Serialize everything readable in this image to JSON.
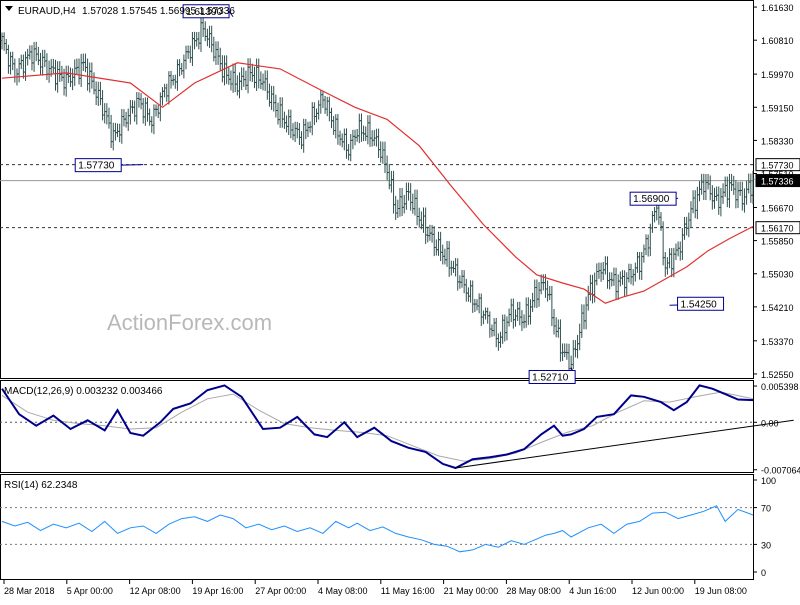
{
  "header": {
    "symbol": "EURAUD,H4",
    "ohlc": "1.57028 1.57545 1.56995 1.57336"
  },
  "watermark": "ActionForex.com",
  "colors": {
    "bars": "#2f4f4f",
    "ma": "#e03030",
    "macd": "#00008b",
    "macd_signal": "#a9a9a9",
    "rsi": "#1e90ff",
    "grid": "#000000",
    "frame": "#000000",
    "label_border": "#00008b"
  },
  "chart_data": [
    {
      "type": "ohlc",
      "panel": "price",
      "title": "EURAUD,H4",
      "y_ticks": [
        "1.61630",
        "1.60810",
        "1.59970",
        "1.59150",
        "1.58330",
        "1.57510",
        "1.56670",
        "1.55850",
        "1.55030",
        "1.54210",
        "1.53370",
        "1.52550"
      ],
      "ylim": [
        1.5245,
        1.6178
      ],
      "x_ticks": [
        "28 Mar 2018",
        "5 Apr 00:00",
        "12 Apr 08:00",
        "19 Apr 16:00",
        "27 Apr 00:00",
        "4 May 08:00",
        "11 May 16:00",
        "21 May 00:00",
        "28 May 08:00",
        "4 Jun 16:00",
        "12 Jun 00:00",
        "19 Jun 08:00"
      ],
      "close_path": [
        [
          0,
          1.608
        ],
        [
          6,
          1.6
        ],
        [
          14,
          1.605
        ],
        [
          22,
          1.601
        ],
        [
          30,
          1.598
        ],
        [
          38,
          1.602
        ],
        [
          46,
          1.593
        ],
        [
          52,
          1.584
        ],
        [
          58,
          1.589
        ],
        [
          64,
          1.593
        ],
        [
          70,
          1.588
        ],
        [
          76,
          1.596
        ],
        [
          82,
          1.6
        ],
        [
          88,
          1.606
        ],
        [
          94,
          1.611
        ],
        [
          98,
          1.607
        ],
        [
          104,
          1.6
        ],
        [
          110,
          1.597
        ],
        [
          116,
          1.6
        ],
        [
          122,
          1.598
        ],
        [
          128,
          1.591
        ],
        [
          134,
          1.587
        ],
        [
          140,
          1.584
        ],
        [
          146,
          1.59
        ],
        [
          150,
          1.594
        ],
        [
          156,
          1.586
        ],
        [
          162,
          1.581
        ],
        [
          166,
          1.586
        ],
        [
          172,
          1.585
        ],
        [
          176,
          1.582
        ],
        [
          180,
          1.576
        ],
        [
          184,
          1.566
        ],
        [
          190,
          1.57
        ],
        [
          196,
          1.563
        ],
        [
          202,
          1.558
        ],
        [
          208,
          1.554
        ],
        [
          214,
          1.549
        ],
        [
          220,
          1.544
        ],
        [
          226,
          1.54
        ],
        [
          232,
          1.534
        ],
        [
          238,
          1.541
        ],
        [
          244,
          1.539
        ],
        [
          250,
          1.546
        ],
        [
          254,
          1.548
        ],
        [
          258,
          1.538
        ],
        [
          262,
          1.531
        ],
        [
          266,
          1.528
        ],
        [
          270,
          1.536
        ],
        [
          274,
          1.545
        ],
        [
          280,
          1.552
        ],
        [
          286,
          1.548
        ],
        [
          292,
          1.549
        ],
        [
          298,
          1.553
        ],
        [
          302,
          1.559
        ],
        [
          306,
          1.568
        ],
        [
          310,
          1.552
        ],
        [
          316,
          1.556
        ],
        [
          322,
          1.566
        ],
        [
          328,
          1.573
        ],
        [
          334,
          1.568
        ],
        [
          340,
          1.572
        ],
        [
          346,
          1.569
        ],
        [
          351,
          1.573
        ]
      ],
      "ma_path": [
        [
          0,
          1.5987
        ],
        [
          30,
          1.6
        ],
        [
          60,
          1.5975
        ],
        [
          75,
          1.5915
        ],
        [
          90,
          1.5975
        ],
        [
          110,
          1.6025
        ],
        [
          130,
          1.601
        ],
        [
          150,
          1.5955
        ],
        [
          165,
          1.5915
        ],
        [
          180,
          1.5885
        ],
        [
          195,
          1.582
        ],
        [
          210,
          1.572
        ],
        [
          225,
          1.5625
        ],
        [
          240,
          1.5545
        ],
        [
          250,
          1.55
        ],
        [
          262,
          1.548
        ],
        [
          272,
          1.5465
        ],
        [
          282,
          1.543
        ],
        [
          290,
          1.5445
        ],
        [
          300,
          1.546
        ],
        [
          310,
          1.549
        ],
        [
          320,
          1.552
        ],
        [
          330,
          1.556
        ],
        [
          340,
          1.559
        ],
        [
          351,
          1.562
        ]
      ],
      "horizontal_lines": [
        {
          "value": 1.5773,
          "style": "dashed",
          "label": "1.57730"
        },
        {
          "value": 1.57336,
          "style": "solid",
          "label": "1.57336"
        },
        {
          "value": 1.5617,
          "style": "dashed",
          "label": "1.56170"
        }
      ],
      "annotations": [
        {
          "label": "1.61390",
          "at": 108,
          "value": 1.6139
        },
        {
          "label": "1.57730",
          "at": 66,
          "value": 1.5773
        },
        {
          "label": "1.56900",
          "at": 316,
          "value": 1.569
        },
        {
          "label": "1.54250",
          "at": 312,
          "value": 1.5425
        },
        {
          "label": "1.52710",
          "at": 266,
          "value": 1.5271
        }
      ]
    },
    {
      "type": "line",
      "panel": "macd",
      "title": "MACD(12,26,9) 0.003232 0.003466",
      "y_ticks": [
        "0.005398",
        "0.00",
        "-0.007064"
      ],
      "ylim": [
        -0.0074,
        0.006
      ],
      "zero_line": true,
      "series": [
        {
          "role": "macd",
          "values": [
            [
              0,
              0.005
            ],
            [
              8,
              0.0012
            ],
            [
              16,
              -0.0005
            ],
            [
              24,
              0.001
            ],
            [
              32,
              -0.001
            ],
            [
              40,
              0.0003
            ],
            [
              48,
              -0.0012
            ],
            [
              54,
              0.0018
            ],
            [
              60,
              -0.0016
            ],
            [
              66,
              -0.002
            ],
            [
              74,
              0.0
            ],
            [
              80,
              0.002
            ],
            [
              88,
              0.0028
            ],
            [
              96,
              0.0048
            ],
            [
              104,
              0.0055
            ],
            [
              112,
              0.0038
            ],
            [
              122,
              -0.001
            ],
            [
              130,
              -0.0008
            ],
            [
              138,
              0.0008
            ],
            [
              146,
              -0.0018
            ],
            [
              152,
              -0.0022
            ],
            [
              160,
              0.0
            ],
            [
              166,
              -0.0022
            ],
            [
              174,
              -0.0008
            ],
            [
              182,
              -0.0028
            ],
            [
              190,
              -0.0038
            ],
            [
              198,
              -0.0044
            ],
            [
              206,
              -0.0062
            ],
            [
              212,
              -0.0068
            ],
            [
              220,
              -0.0055
            ],
            [
              228,
              -0.0052
            ],
            [
              236,
              -0.0048
            ],
            [
              244,
              -0.004
            ],
            [
              252,
              -0.0018
            ],
            [
              258,
              -0.0005
            ],
            [
              262,
              -0.002
            ],
            [
              266,
              -0.0018
            ],
            [
              272,
              -0.001
            ],
            [
              278,
              0.0008
            ],
            [
              286,
              0.0012
            ],
            [
              294,
              0.004
            ],
            [
              300,
              0.0038
            ],
            [
              308,
              0.003
            ],
            [
              314,
              0.0018
            ],
            [
              320,
              0.003
            ],
            [
              326,
              0.0055
            ],
            [
              332,
              0.005
            ],
            [
              338,
              0.0042
            ],
            [
              344,
              0.0034
            ],
            [
              351,
              0.0033
            ]
          ]
        },
        {
          "role": "signal",
          "values": [
            [
              0,
              0.004
            ],
            [
              12,
              0.0015
            ],
            [
              24,
              0.0003
            ],
            [
              36,
              -0.0002
            ],
            [
              48,
              -0.0005
            ],
            [
              60,
              -0.001
            ],
            [
              72,
              -0.0008
            ],
            [
              84,
              0.0015
            ],
            [
              96,
              0.0035
            ],
            [
              108,
              0.0042
            ],
            [
              120,
              0.0018
            ],
            [
              132,
              -0.0002
            ],
            [
              144,
              -0.0008
            ],
            [
              156,
              -0.0012
            ],
            [
              168,
              -0.0015
            ],
            [
              180,
              -0.002
            ],
            [
              192,
              -0.0035
            ],
            [
              204,
              -0.005
            ],
            [
              216,
              -0.0058
            ],
            [
              228,
              -0.0054
            ],
            [
              240,
              -0.0046
            ],
            [
              252,
              -0.003
            ],
            [
              264,
              -0.0015
            ],
            [
              276,
              -0.0005
            ],
            [
              288,
              0.0015
            ],
            [
              300,
              0.0032
            ],
            [
              312,
              0.003
            ],
            [
              324,
              0.0038
            ],
            [
              336,
              0.0045
            ],
            [
              351,
              0.0035
            ]
          ]
        }
      ],
      "trendline": [
        [
          212,
          -0.0068
        ],
        [
          370,
          0.0003
        ]
      ]
    },
    {
      "type": "line",
      "panel": "rsi",
      "title": "RSI(14) 62.2348",
      "y_ticks": [
        "100",
        "70",
        "30",
        "0"
      ],
      "ylim": [
        0,
        100
      ],
      "levels": [
        70,
        30
      ],
      "series": [
        {
          "role": "rsi",
          "values": [
            [
              0,
              55
            ],
            [
              6,
              50
            ],
            [
              12,
              54
            ],
            [
              18,
              45
            ],
            [
              24,
              52
            ],
            [
              30,
              48
            ],
            [
              36,
              53
            ],
            [
              42,
              44
            ],
            [
              48,
              55
            ],
            [
              54,
              42
            ],
            [
              60,
              48
            ],
            [
              66,
              50
            ],
            [
              72,
              42
            ],
            [
              78,
              52
            ],
            [
              84,
              58
            ],
            [
              90,
              60
            ],
            [
              96,
              55
            ],
            [
              102,
              62
            ],
            [
              108,
              58
            ],
            [
              114,
              48
            ],
            [
              120,
              52
            ],
            [
              126,
              46
            ],
            [
              132,
              50
            ],
            [
              138,
              44
            ],
            [
              144,
              48
            ],
            [
              150,
              42
            ],
            [
              156,
              55
            ],
            [
              162,
              48
            ],
            [
              166,
              53
            ],
            [
              172,
              45
            ],
            [
              178,
              49
            ],
            [
              184,
              42
            ],
            [
              190,
              38
            ],
            [
              196,
              35
            ],
            [
              202,
              30
            ],
            [
              208,
              28
            ],
            [
              214,
              22
            ],
            [
              220,
              24
            ],
            [
              226,
              30
            ],
            [
              232,
              27
            ],
            [
              238,
              34
            ],
            [
              244,
              30
            ],
            [
              250,
              36
            ],
            [
              254,
              40
            ],
            [
              258,
              42
            ],
            [
              262,
              45
            ],
            [
              266,
              38
            ],
            [
              270,
              43
            ],
            [
              274,
              48
            ],
            [
              280,
              52
            ],
            [
              286,
              42
            ],
            [
              292,
              52
            ],
            [
              298,
              55
            ],
            [
              304,
              64
            ],
            [
              310,
              65
            ],
            [
              316,
              58
            ],
            [
              322,
              62
            ],
            [
              328,
              66
            ],
            [
              334,
              72
            ],
            [
              338,
              55
            ],
            [
              344,
              68
            ],
            [
              351,
              62
            ]
          ]
        }
      ]
    }
  ]
}
